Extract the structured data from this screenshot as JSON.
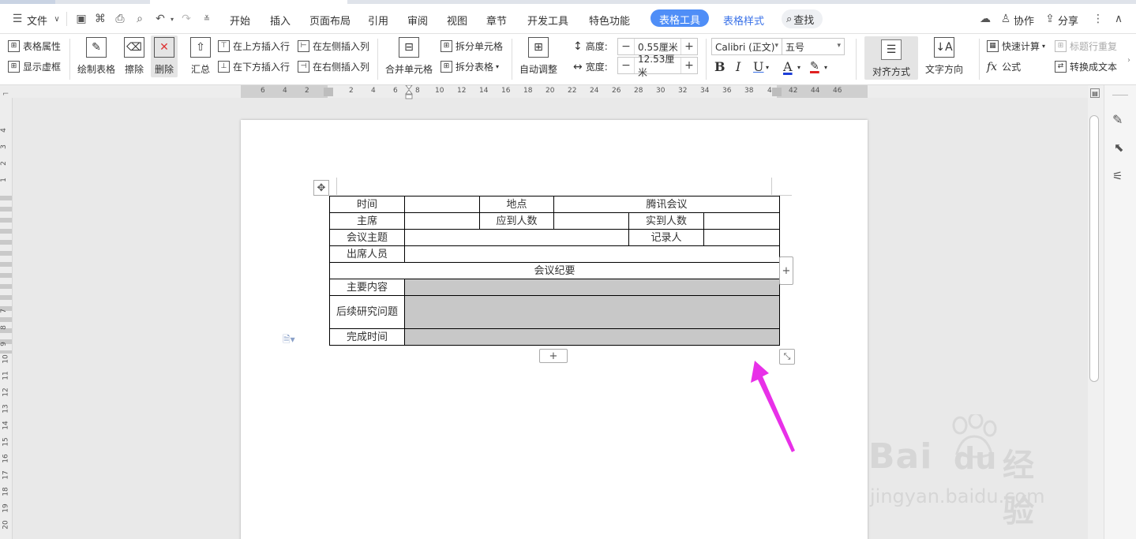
{
  "menubar": {
    "file_label": "文件",
    "tabs": [
      "开始",
      "插入",
      "页面布局",
      "引用",
      "审阅",
      "视图",
      "章节",
      "开发工具",
      "特色功能"
    ],
    "table_tools_label": "表格工具",
    "table_style_label": "表格样式",
    "search_label": "查找",
    "collab_label": "协作",
    "share_label": "分享"
  },
  "ribbon": {
    "table_props": "表格属性",
    "show_gridlines": "显示虚框",
    "draw_table": "绘制表格",
    "eraser": "擦除",
    "delete": "删除",
    "summary": "汇总",
    "insert_row_above": "在上方插入行",
    "insert_row_below": "在下方插入行",
    "insert_col_left": "在左侧插入列",
    "insert_col_right": "在右侧插入列",
    "merge_cells": "合并单元格",
    "split_cells": "拆分单元格",
    "split_table": "拆分表格",
    "auto_fit": "自动调整",
    "height_label": "高度:",
    "height_value": "0.55厘米",
    "width_label": "宽度:",
    "width_value": "12.53厘米",
    "font_name": "Calibri (正文)",
    "font_size": "五号",
    "align": "对齐方式",
    "text_direction": "文字方向",
    "quick_calc": "快速计算",
    "repeat_title_row": "标题行重复",
    "formula": "公式",
    "to_text": "转换成文本"
  },
  "ruler": {
    "ticks": [
      "6",
      "4",
      "2",
      "2",
      "4",
      "6",
      "8",
      "10",
      "12",
      "14",
      "16",
      "18",
      "20",
      "22",
      "24",
      "26",
      "28",
      "30",
      "32",
      "34",
      "36",
      "38",
      "4",
      "42",
      "44",
      "46"
    ]
  },
  "vruler": {
    "ticks": [
      "4",
      "3",
      "2",
      "1",
      "7",
      "8",
      "9",
      "10",
      "11",
      "12",
      "13",
      "14",
      "15",
      "16",
      "17",
      "18",
      "19",
      "20"
    ]
  },
  "table": {
    "time": "时间",
    "place": "地点",
    "place_value": "腾讯会议",
    "chair": "主席",
    "expected": "应到人数",
    "actual": "实到人数",
    "topic": "会议主题",
    "recorder": "记录人",
    "attendees": "出席人员",
    "minutes": "会议纪要",
    "main_content": "主要内容",
    "follow_up": "后续研究问题",
    "deadline": "完成时间"
  },
  "watermark": {
    "brand_left": "Bai",
    "brand_right": "经验",
    "url": "jingyan.baidu.com"
  },
  "colors": {
    "accent": "#4f8ef7",
    "arrow": "#e830e8"
  }
}
